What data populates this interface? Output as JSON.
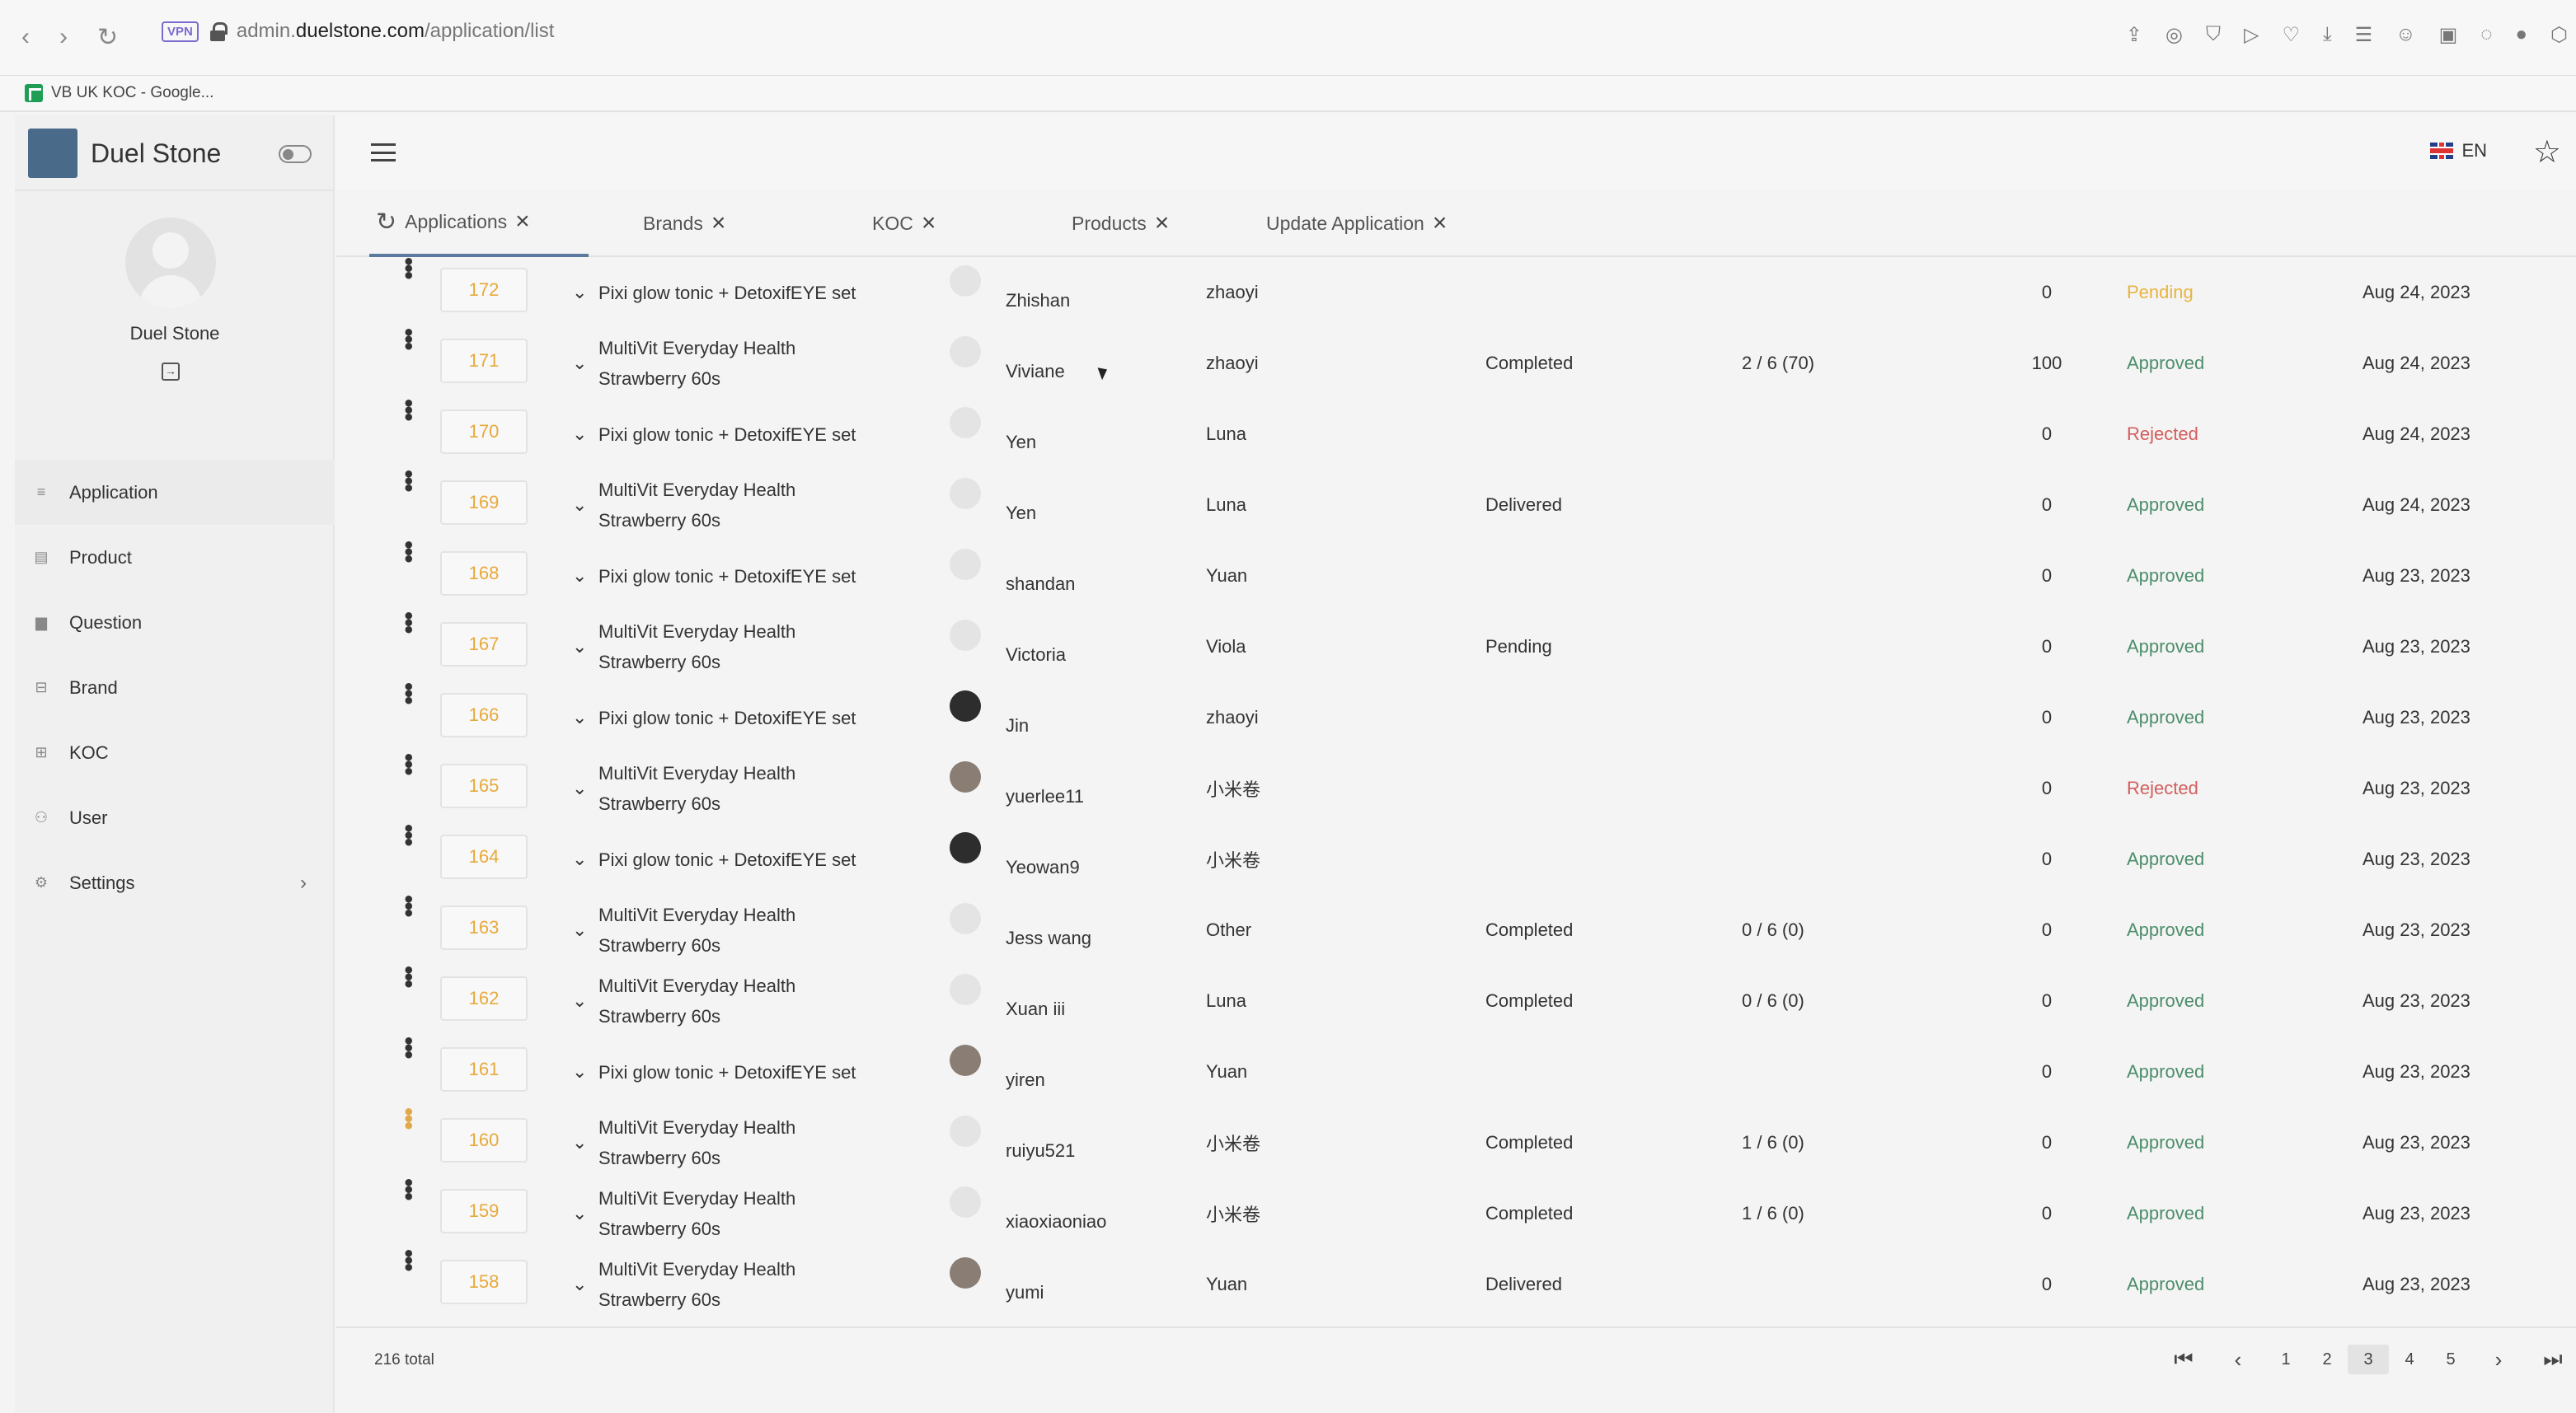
{
  "browser": {
    "url_prefix": "admin.",
    "url_domain": "duelstone.com",
    "url_path": "/application/list",
    "vpn_label": "VPN",
    "bookmark_label": "VB UK KOC - Google..."
  },
  "sidebar": {
    "brand": "Duel Stone",
    "user_name": "Duel Stone",
    "items": [
      {
        "label": "Application",
        "icon": "list-icon",
        "active": true
      },
      {
        "label": "Product",
        "icon": "box-icon"
      },
      {
        "label": "Question",
        "icon": "question-icon"
      },
      {
        "label": "Brand",
        "icon": "store-icon"
      },
      {
        "label": "KOC",
        "icon": "id-card-icon"
      },
      {
        "label": "User",
        "icon": "users-icon"
      },
      {
        "label": "Settings",
        "icon": "gear-icon"
      }
    ]
  },
  "header": {
    "lang": "EN"
  },
  "tabs": [
    {
      "label": "Applications"
    },
    {
      "label": "Brands"
    },
    {
      "label": "KOC"
    },
    {
      "label": "Products"
    },
    {
      "label": "Update Application"
    }
  ],
  "rows": [
    {
      "id": "172",
      "product": "Pixi glow tonic + DetoxifEYE set",
      "user": "Zhishan",
      "koc": "zhaoyi",
      "stage": "",
      "ratio": "",
      "num": "0",
      "status": "Pending",
      "date": "Aug 24, 2023",
      "avatar": "default"
    },
    {
      "id": "171",
      "product": "MultiVit Everyday Health Strawberry 60s",
      "user": "Viviane",
      "koc": "zhaoyi",
      "stage": "Completed",
      "ratio": "2 / 6 (70)",
      "num": "100",
      "status": "Approved",
      "date": "Aug 24, 2023",
      "avatar": "default"
    },
    {
      "id": "170",
      "product": "Pixi glow tonic + DetoxifEYE set",
      "user": "Yen",
      "koc": "Luna",
      "stage": "",
      "ratio": "",
      "num": "0",
      "status": "Rejected",
      "date": "Aug 24, 2023",
      "avatar": "default"
    },
    {
      "id": "169",
      "product": "MultiVit Everyday Health Strawberry 60s",
      "user": "Yen",
      "koc": "Luna",
      "stage": "Delivered",
      "ratio": "",
      "num": "0",
      "status": "Approved",
      "date": "Aug 24, 2023",
      "avatar": "default"
    },
    {
      "id": "168",
      "product": "Pixi glow tonic + DetoxifEYE set",
      "user": "shandan",
      "koc": "Yuan",
      "stage": "",
      "ratio": "",
      "num": "0",
      "status": "Approved",
      "date": "Aug 23, 2023",
      "avatar": "default"
    },
    {
      "id": "167",
      "product": "MultiVit Everyday Health Strawberry 60s",
      "user": "Victoria",
      "koc": "Viola",
      "stage": "Pending",
      "ratio": "",
      "num": "0",
      "status": "Approved",
      "date": "Aug 23, 2023",
      "avatar": "default"
    },
    {
      "id": "166",
      "product": "Pixi glow tonic + DetoxifEYE set",
      "user": "Jin",
      "koc": "zhaoyi",
      "stage": "",
      "ratio": "",
      "num": "0",
      "status": "Approved",
      "date": "Aug 23, 2023",
      "avatar": "dark"
    },
    {
      "id": "165",
      "product": "MultiVit Everyday Health Strawberry 60s",
      "user": "yuerlee11",
      "koc": "小米卷",
      "stage": "",
      "ratio": "",
      "num": "0",
      "status": "Rejected",
      "date": "Aug 23, 2023",
      "avatar": "photo"
    },
    {
      "id": "164",
      "product": "Pixi glow tonic + DetoxifEYE set",
      "user": "Yeowan9",
      "koc": "小米卷",
      "stage": "",
      "ratio": "",
      "num": "0",
      "status": "Approved",
      "date": "Aug 23, 2023",
      "avatar": "dark"
    },
    {
      "id": "163",
      "product": "MultiVit Everyday Health Strawberry 60s",
      "user": "Jess wang",
      "koc": "Other",
      "stage": "Completed",
      "ratio": "0 / 6 (0)",
      "num": "0",
      "status": "Approved",
      "date": "Aug 23, 2023",
      "avatar": "default"
    },
    {
      "id": "162",
      "product": "MultiVit Everyday Health Strawberry 60s",
      "user": "Xuan iii",
      "koc": "Luna",
      "stage": "Completed",
      "ratio": "0 / 6 (0)",
      "num": "0",
      "status": "Approved",
      "date": "Aug 23, 2023",
      "avatar": "default"
    },
    {
      "id": "161",
      "product": "Pixi glow tonic + DetoxifEYE set",
      "user": "yiren",
      "koc": "Yuan",
      "stage": "",
      "ratio": "",
      "num": "0",
      "status": "Approved",
      "date": "Aug 23, 2023",
      "avatar": "photo"
    },
    {
      "id": "160",
      "product": "MultiVit Everyday Health Strawberry 60s",
      "user": "ruiyu521",
      "koc": "小米卷",
      "stage": "Completed",
      "ratio": "1 / 6 (0)",
      "num": "0",
      "status": "Approved",
      "date": "Aug 23, 2023",
      "avatar": "default",
      "highlight": true
    },
    {
      "id": "159",
      "product": "MultiVit Everyday Health Strawberry 60s",
      "user": "xiaoxiaoniao",
      "koc": "小米卷",
      "stage": "Completed",
      "ratio": "1 / 6 (0)",
      "num": "0",
      "status": "Approved",
      "date": "Aug 23, 2023",
      "avatar": "default"
    },
    {
      "id": "158",
      "product": "MultiVit Everyday Health Strawberry 60s",
      "user": "yumi",
      "koc": "Yuan",
      "stage": "Delivered",
      "ratio": "",
      "num": "0",
      "status": "Approved",
      "date": "Aug 23, 2023",
      "avatar": "photo"
    }
  ],
  "footer": {
    "total": "216 total",
    "pages": [
      "1",
      "2",
      "3",
      "4",
      "5"
    ],
    "current_page": "3"
  },
  "colors": {
    "pending": "#e8b440",
    "approved": "#4c8d6a",
    "rejected": "#d55d5d",
    "id": "#e8a93a"
  }
}
